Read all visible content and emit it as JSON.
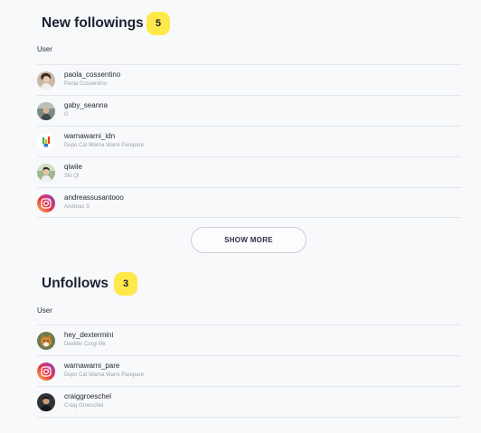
{
  "new_followings": {
    "title": "New followings",
    "count": "5",
    "column_header": "User",
    "items": [
      {
        "username": "paola_cossentino",
        "full_name": "Paola Cossentino",
        "avatar_icon": "woman-portrait-avatar"
      },
      {
        "username": "gaby_seanna",
        "full_name": "G",
        "avatar_icon": "person-portrait-avatar"
      },
      {
        "username": "warnawarni_idn",
        "full_name": "Depo Cat Warna Warni Parepare",
        "avatar_icon": "paint-brand-logo-avatar"
      },
      {
        "username": "qiwiie",
        "full_name": "Shi Qi",
        "avatar_icon": "outdoor-portrait-avatar"
      },
      {
        "username": "andreassusantooo",
        "full_name": "Andreas S",
        "avatar_icon": "instagram-default-avatar"
      }
    ],
    "show_more_label": "SHOW MORE"
  },
  "unfollows": {
    "title": "Unfollows",
    "count": "3",
    "column_header": "User",
    "items": [
      {
        "username": "hey_dextermini",
        "full_name": "DexMin Corgi life",
        "avatar_icon": "corgi-dog-avatar"
      },
      {
        "username": "warnawarni_pare",
        "full_name": "Depo Cat Warna Warni Parepare",
        "avatar_icon": "instagram-default-avatar"
      },
      {
        "username": "craiggroeschel",
        "full_name": "Craig Groeschel",
        "avatar_icon": "man-portrait-avatar"
      }
    ]
  },
  "colors": {
    "badge": "#ffe94a",
    "background": "#f8f9fb",
    "divider": "#e3e6ea",
    "secondary_text": "#9aa0aa"
  }
}
